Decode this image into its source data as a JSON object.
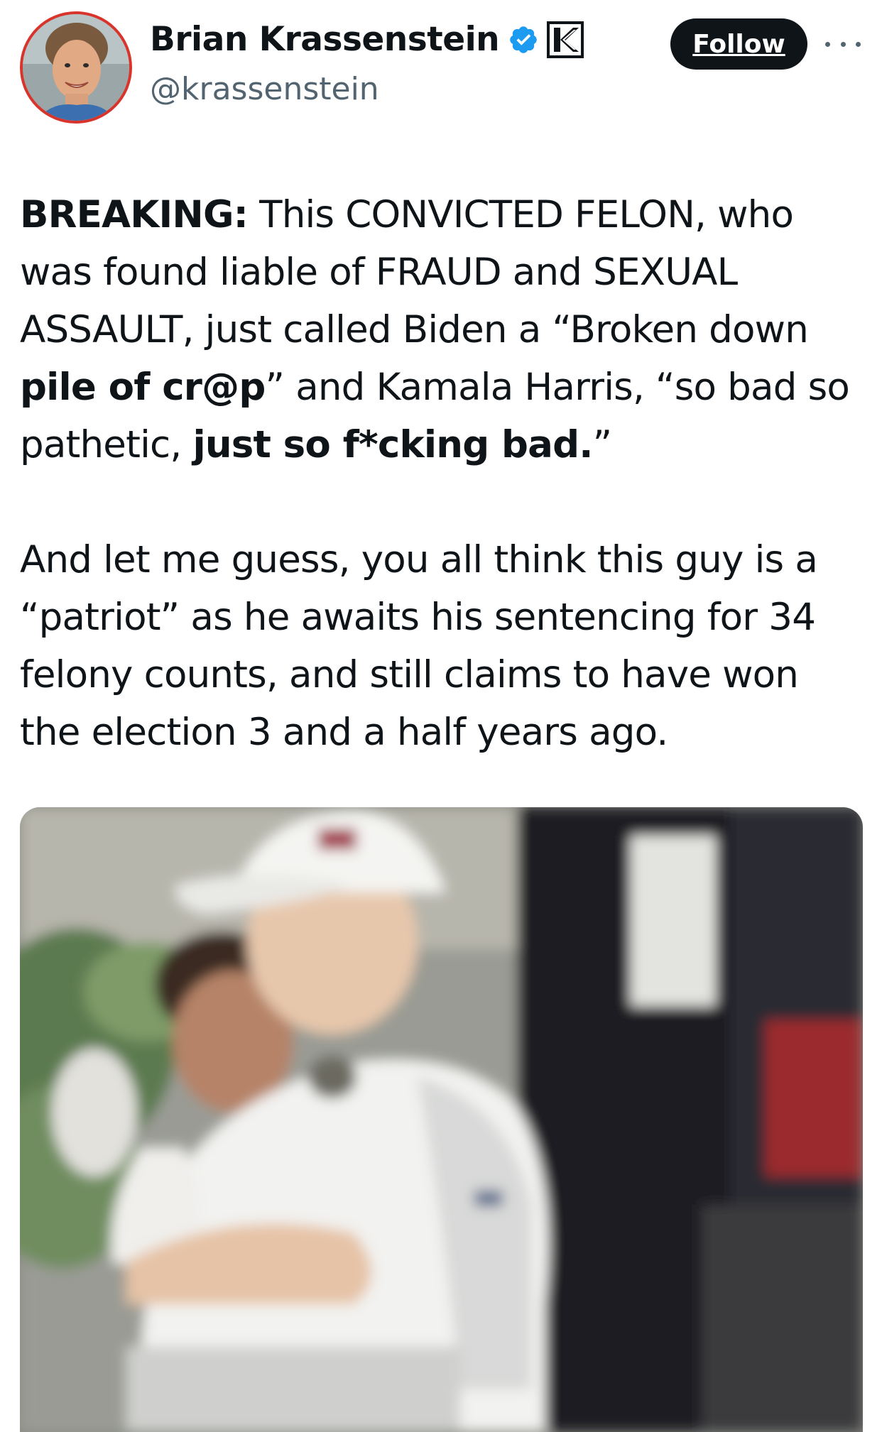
{
  "author": {
    "display_name": "Brian Krassenstein",
    "handle": "@krassenstein",
    "verified_icon": "verified-badge-icon",
    "affiliate_icon": "k-affiliate-icon"
  },
  "actions": {
    "follow_label": "Follow",
    "more_icon": "more-options-icon"
  },
  "tweet": {
    "p1_bold_breaking": "BREAKING:",
    "p1_part1": " This CONVICTED FELON, who was found liable of FRAUD and SEXUAL ASSAULT, just called Biden a “Broken down ",
    "p1_bold_pile": "pile of cr@p",
    "p1_part2": "” and Kamala Harris, “so bad so pathetic, ",
    "p1_bold_bad": "just so f*cking bad.",
    "p1_part3": "”",
    "p2": "And let me guess, you all think this guy is a “patriot” as he awaits his sentencing for 34 felony counts, and still claims to have won the election 3 and a half years ago."
  },
  "colors": {
    "text": "#0f1419",
    "secondary_text": "#536471",
    "verified_blue": "#1d9bf0",
    "follow_bg": "#0f1419",
    "avatar_ring": "#d9342b"
  }
}
